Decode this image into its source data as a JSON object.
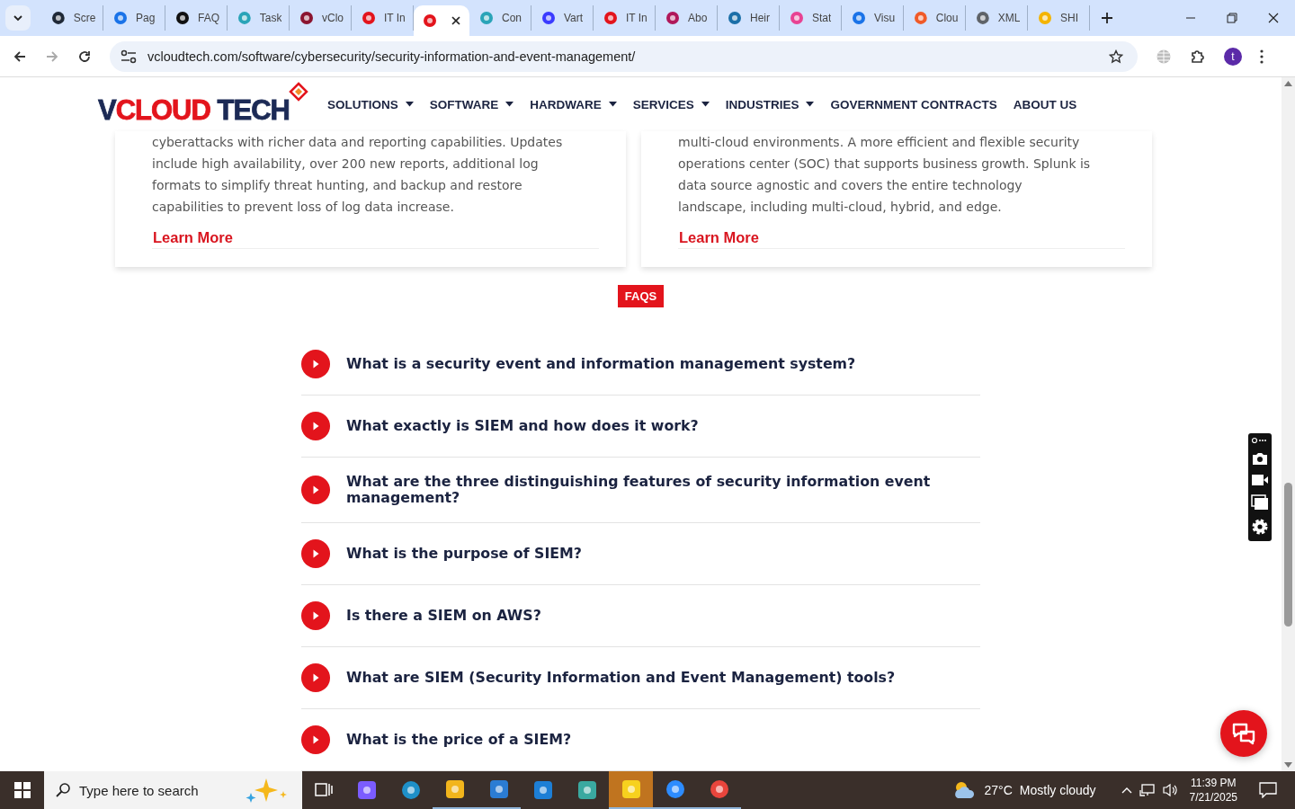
{
  "browser": {
    "tabs": [
      {
        "title": "Scre",
        "selected": false
      },
      {
        "title": "Pag",
        "selected": false
      },
      {
        "title": "FAQ",
        "selected": false
      },
      {
        "title": "Task",
        "selected": false
      },
      {
        "title": "vClo",
        "selected": false
      },
      {
        "title": "IT In",
        "selected": false
      },
      {
        "selected": true
      },
      {
        "title": "Con",
        "selected": false
      },
      {
        "title": "Vart",
        "selected": false
      },
      {
        "title": "IT In",
        "selected": false
      },
      {
        "title": "Abo",
        "selected": false
      },
      {
        "title": "Heir",
        "selected": false
      },
      {
        "title": "Stat",
        "selected": false
      },
      {
        "title": "Visu",
        "selected": false
      },
      {
        "title": "Clou",
        "selected": false
      },
      {
        "title": "XML",
        "selected": false
      },
      {
        "title": "SHI",
        "selected": false
      }
    ],
    "url": "vcloudtech.com/software/cybersecurity/security-information-and-event-management/",
    "profile_initial": "t"
  },
  "header": {
    "logo": [
      {
        "text": "V",
        "color": "#1c2a55"
      },
      {
        "text": "CLOUD",
        "color": "#e3141c"
      },
      {
        "text": " TECH",
        "color": "#1c2a55"
      }
    ],
    "nav": [
      {
        "label": "SOLUTIONS",
        "dropdown": true
      },
      {
        "label": "SOFTWARE",
        "dropdown": true
      },
      {
        "label": "HARDWARE",
        "dropdown": true
      },
      {
        "label": "SERVICES",
        "dropdown": true
      },
      {
        "label": "INDUSTRIES",
        "dropdown": true
      },
      {
        "label": "GOVERNMENT CONTRACTS",
        "dropdown": false
      },
      {
        "label": "ABOUT US",
        "dropdown": false
      }
    ]
  },
  "cards": [
    {
      "lines": [
        "cyberattacks with richer data and reporting capabilities. Updates",
        "include high availability, over 200 new reports, additional log",
        "formats to simplify threat hunting, and backup and restore",
        "capabilities to prevent loss of log data increase."
      ],
      "link": "Learn More"
    },
    {
      "lines": [
        "multi-cloud environments. A more efficient and flexible security",
        "operations center (SOC) that supports business growth. Splunk is",
        "data source agnostic and covers the entire technology",
        "landscape, including multi-cloud, hybrid, and edge."
      ],
      "link": "Learn More"
    }
  ],
  "faq": {
    "badge": "FAQS",
    "questions": [
      "What is a security event and information management system?",
      "What exactly is SIEM and how does it work?",
      "What are the three distinguishing features of security information event management?",
      "What is the purpose of SIEM?",
      "Is there a SIEM on AWS?",
      "What are SIEM (Security Information and Event Management) tools?",
      "What is the price of a SIEM?"
    ]
  },
  "taskbar": {
    "search_placeholder": "Type here to search",
    "apps": [
      {
        "running": false,
        "flashing": false
      },
      {
        "running": false,
        "flashing": false
      },
      {
        "running": true,
        "flashing": false
      },
      {
        "running": true,
        "flashing": false
      },
      {
        "running": false,
        "flashing": false
      },
      {
        "running": false,
        "flashing": false
      },
      {
        "running": true,
        "flashing": true
      },
      {
        "running": true,
        "flashing": false
      },
      {
        "running": true,
        "flashing": false
      }
    ],
    "temperature": "27°C",
    "weather": "Mostly cloudy",
    "time": "11:39 PM",
    "date": "7/21/2025"
  }
}
